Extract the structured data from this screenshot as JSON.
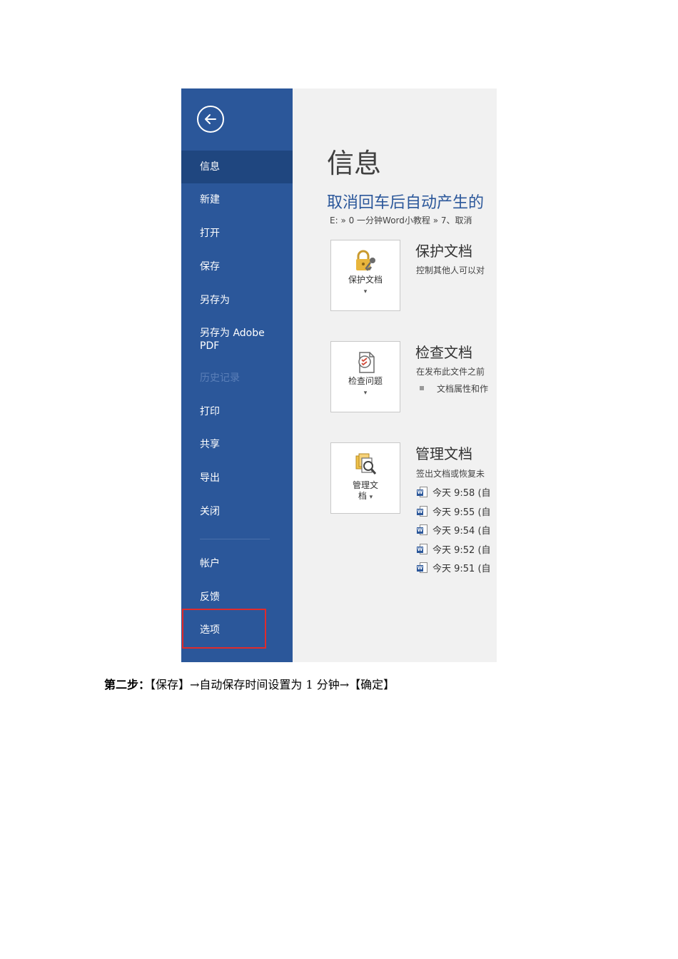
{
  "sidebar": {
    "items": [
      {
        "label": "信息"
      },
      {
        "label": "新建"
      },
      {
        "label": "打开"
      },
      {
        "label": "保存"
      },
      {
        "label": "另存为"
      },
      {
        "label": "另存为 Adobe PDF"
      },
      {
        "label": "历史记录"
      },
      {
        "label": "打印"
      },
      {
        "label": "共享"
      },
      {
        "label": "导出"
      },
      {
        "label": "关闭"
      },
      {
        "label": "帐户"
      },
      {
        "label": "反馈"
      },
      {
        "label": "选项"
      }
    ]
  },
  "main": {
    "title": "信息",
    "doc_title": "取消回车后自动产生的",
    "path": "E: » 0 一分钟Word小教程 » 7、取消",
    "protect": {
      "button_label": "保护文档",
      "title": "保护文档",
      "desc": "控制其他人可以对"
    },
    "inspect": {
      "button_label": "检查问题",
      "title": "检查文档",
      "desc": "在发布此文件之前",
      "bullet": "文档属性和作"
    },
    "manage": {
      "button_label_line1": "管理文",
      "button_label_line2": "档",
      "title": "管理文档",
      "desc": "签出文档或恢复未",
      "versions": [
        "今天 9:58 (自",
        "今天 9:55 (自",
        "今天 9:54 (自",
        "今天 9:52 (自",
        "今天 9:51 (自"
      ]
    },
    "caret": "▾"
  },
  "caption": {
    "step": "第二步：",
    "text": "【保存】→自动保存时间设置为 1 分钟→【确定】"
  },
  "colors": {
    "sidebar_bg": "#2b579a",
    "active_bg": "#1f467f",
    "highlight": "#e02b2b"
  }
}
